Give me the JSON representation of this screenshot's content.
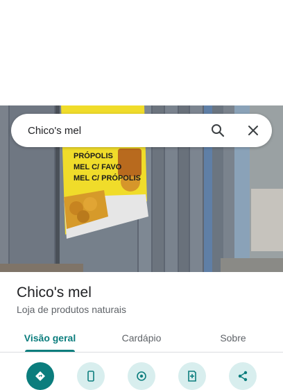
{
  "search": {
    "query": "Chico's mel"
  },
  "photo": {
    "banner_lines": [
      "PRÓPOLIS",
      "MEL C/ FAVO",
      "MEL C/ PRÓPOLIS"
    ]
  },
  "place": {
    "name": "Chico's mel",
    "category": "Loja de produtos naturais"
  },
  "tabs": [
    {
      "label": "Visão geral",
      "active": true
    },
    {
      "label": "Cardápio",
      "active": false
    },
    {
      "label": "Sobre",
      "active": false
    }
  ],
  "actions": [
    {
      "icon": "directions-icon"
    },
    {
      "icon": "phone-icon"
    },
    {
      "icon": "location-icon"
    },
    {
      "icon": "save-icon"
    },
    {
      "icon": "share-icon"
    }
  ],
  "colors": {
    "accent": "#0b7d7d",
    "action_bg": "#d8eeee"
  }
}
